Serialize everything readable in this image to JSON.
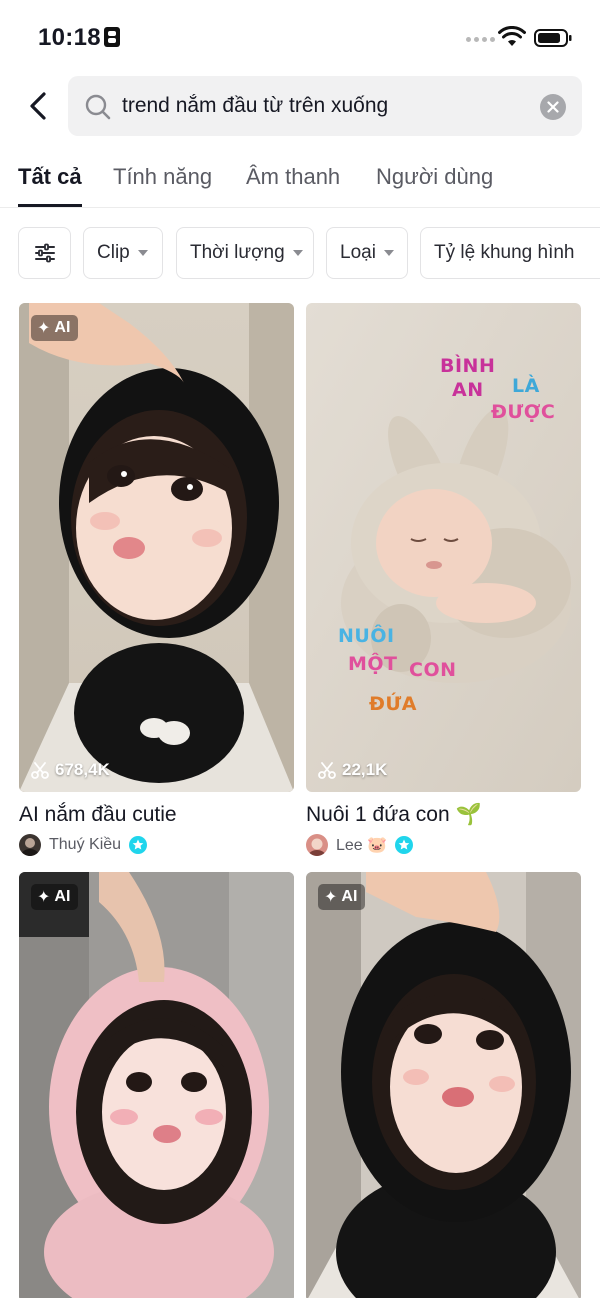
{
  "status_bar": {
    "time": "10:18"
  },
  "search": {
    "query": "trend nắm đầu từ trên xuống"
  },
  "tabs": [
    {
      "label": "Tất cả",
      "active": true
    },
    {
      "label": "Tính năng"
    },
    {
      "label": "Âm thanh"
    },
    {
      "label": "Người dùng"
    }
  ],
  "filters": {
    "settings_icon": "sliders-icon",
    "chips": [
      {
        "label": "Clip"
      },
      {
        "label": "Thời lượng"
      },
      {
        "label": "Loại"
      },
      {
        "label": "Tỷ lệ khung hình"
      }
    ]
  },
  "results": [
    {
      "badge": "AI",
      "uses": "678,4K",
      "title": "AI nắm đầu cutie",
      "author": "Thuý Kiều",
      "verified": true
    },
    {
      "badge": "",
      "uses": "22,1K",
      "title": "Nuôi 1 đứa con 🌱",
      "author": "Lee 🐷",
      "verified": true,
      "stickers": [
        "BÌNH",
        "AN",
        "LÀ",
        "ĐƯỢC",
        "NUÔI",
        "MỘT",
        "CON",
        "ĐỨA"
      ]
    },
    {
      "badge": "AI"
    },
    {
      "badge": "AI"
    }
  ],
  "colors": {
    "accent": "#161823",
    "verified": "#20d5ec",
    "chip_border": "#e3e3e5",
    "search_bg": "#f1f1f2"
  }
}
